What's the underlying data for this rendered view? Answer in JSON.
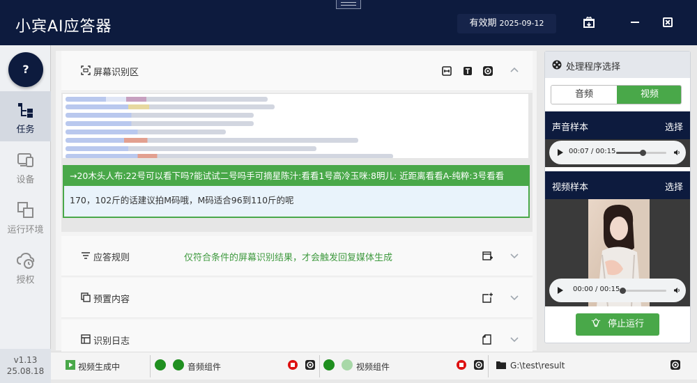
{
  "titlebar": {
    "app_title": "小宾AI应答器",
    "validity_label": "有效期",
    "validity_date": "2025-09-12"
  },
  "sidebar": {
    "help_label": "?",
    "items": [
      {
        "label": "任务",
        "icon": "task-icon",
        "active": true
      },
      {
        "label": "设备",
        "icon": "device-icon",
        "active": false
      },
      {
        "label": "运行环境",
        "icon": "environment-icon",
        "active": false
      },
      {
        "label": "授权",
        "icon": "license-icon",
        "active": false
      }
    ],
    "version": "v1.13",
    "build_date": "25.08.18"
  },
  "main": {
    "screen_section": {
      "title": "屏幕识别区",
      "ocr_line1": "→20木头人布:22号可以看下吗?能试试二号吗手可摘星陈汁:看看1号高冷玉咪:8明儿: 近距离看看A-纯粹:3号看看",
      "ocr_line2": "170，102斤的话建议拍M码哦，M码适合96到110斤的呢"
    },
    "rules_section": {
      "title": "应答规则",
      "description": "仅符合条件的屏幕识别结果，才会触发回复媒体生成"
    },
    "preset_section": {
      "title": "预置内容"
    },
    "log_section": {
      "title": "识别日志"
    }
  },
  "right_panel": {
    "title": "处理程序选择",
    "tab_audio": "音频",
    "tab_video": "视频",
    "audio_sample": {
      "title": "声音样本",
      "select_label": "选择",
      "time": "00:07 / 00:15",
      "progress": 0.53
    },
    "video_sample": {
      "title": "视频样本",
      "select_label": "选择",
      "time": "00:00 / 00:15",
      "progress": 0.02
    },
    "stop_label": "停止运行"
  },
  "statusbar": {
    "video_status": "视频生成中",
    "audio_component": "音频组件",
    "video_component": "视频组件",
    "result_path": "G:\\test\\result"
  },
  "colors": {
    "navy": "#0d1b3e",
    "green": "#49a849",
    "record_red": "#dd1111"
  }
}
